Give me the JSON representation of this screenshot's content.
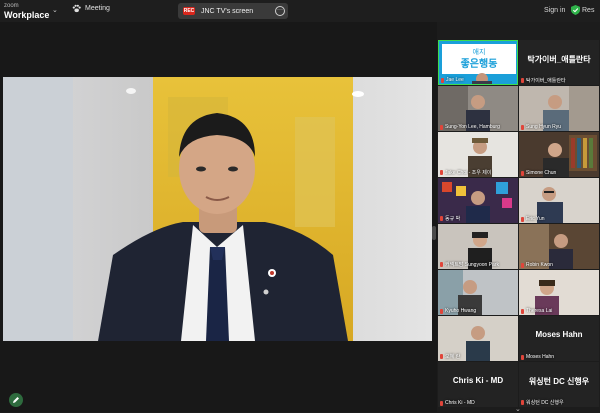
{
  "app": {
    "brand_line1": "zoom",
    "brand_line2": "Workplace",
    "meeting_label": "Meeting",
    "share_label": "JNC TV's screen",
    "rec_label": "REC",
    "sign_in": "Sign in",
    "right_label": "Res",
    "colors": {
      "accent_green": "#3ddc4f",
      "rec_red": "#d9261c"
    }
  },
  "participants": [
    {
      "name": "Jae Lee",
      "big": "",
      "active": true
    },
    {
      "name": "탁가이버_애틀란타",
      "big": "탁가이버_애틀란타",
      "active": false
    },
    {
      "name": "Sung-Yon Lee, Hamburg",
      "big": "",
      "active": false
    },
    {
      "name": "Sung Hyun Ryu",
      "big": "",
      "active": false
    },
    {
      "name": "Jake Choi - 조우 제이",
      "big": "",
      "active": false
    },
    {
      "name": "Simone Chun",
      "big": "",
      "active": false
    },
    {
      "name": "동규 박",
      "big": "",
      "active": false
    },
    {
      "name": "Eric Yun",
      "big": "",
      "active": false
    },
    {
      "name": "커넥트맘 Sungyoon Park",
      "big": "",
      "active": false
    },
    {
      "name": "Robin Kwon",
      "big": "",
      "active": false
    },
    {
      "name": "Kyuho Hwang",
      "big": "",
      "active": false
    },
    {
      "name": "Theresa Lai",
      "big": "",
      "active": false
    },
    {
      "name": "오혜 란",
      "big": "",
      "active": false
    },
    {
      "name": "Moses Hahn",
      "big": "Moses Hahn",
      "active": false
    },
    {
      "name": "Chris Ki - MD",
      "big": "Chris Ki - MD",
      "active": false
    },
    {
      "name": "워싱턴 DC 신행우",
      "big": "워싱턴 DC 신행우",
      "active": false
    }
  ],
  "banner_text": "애지 좋은 행동"
}
